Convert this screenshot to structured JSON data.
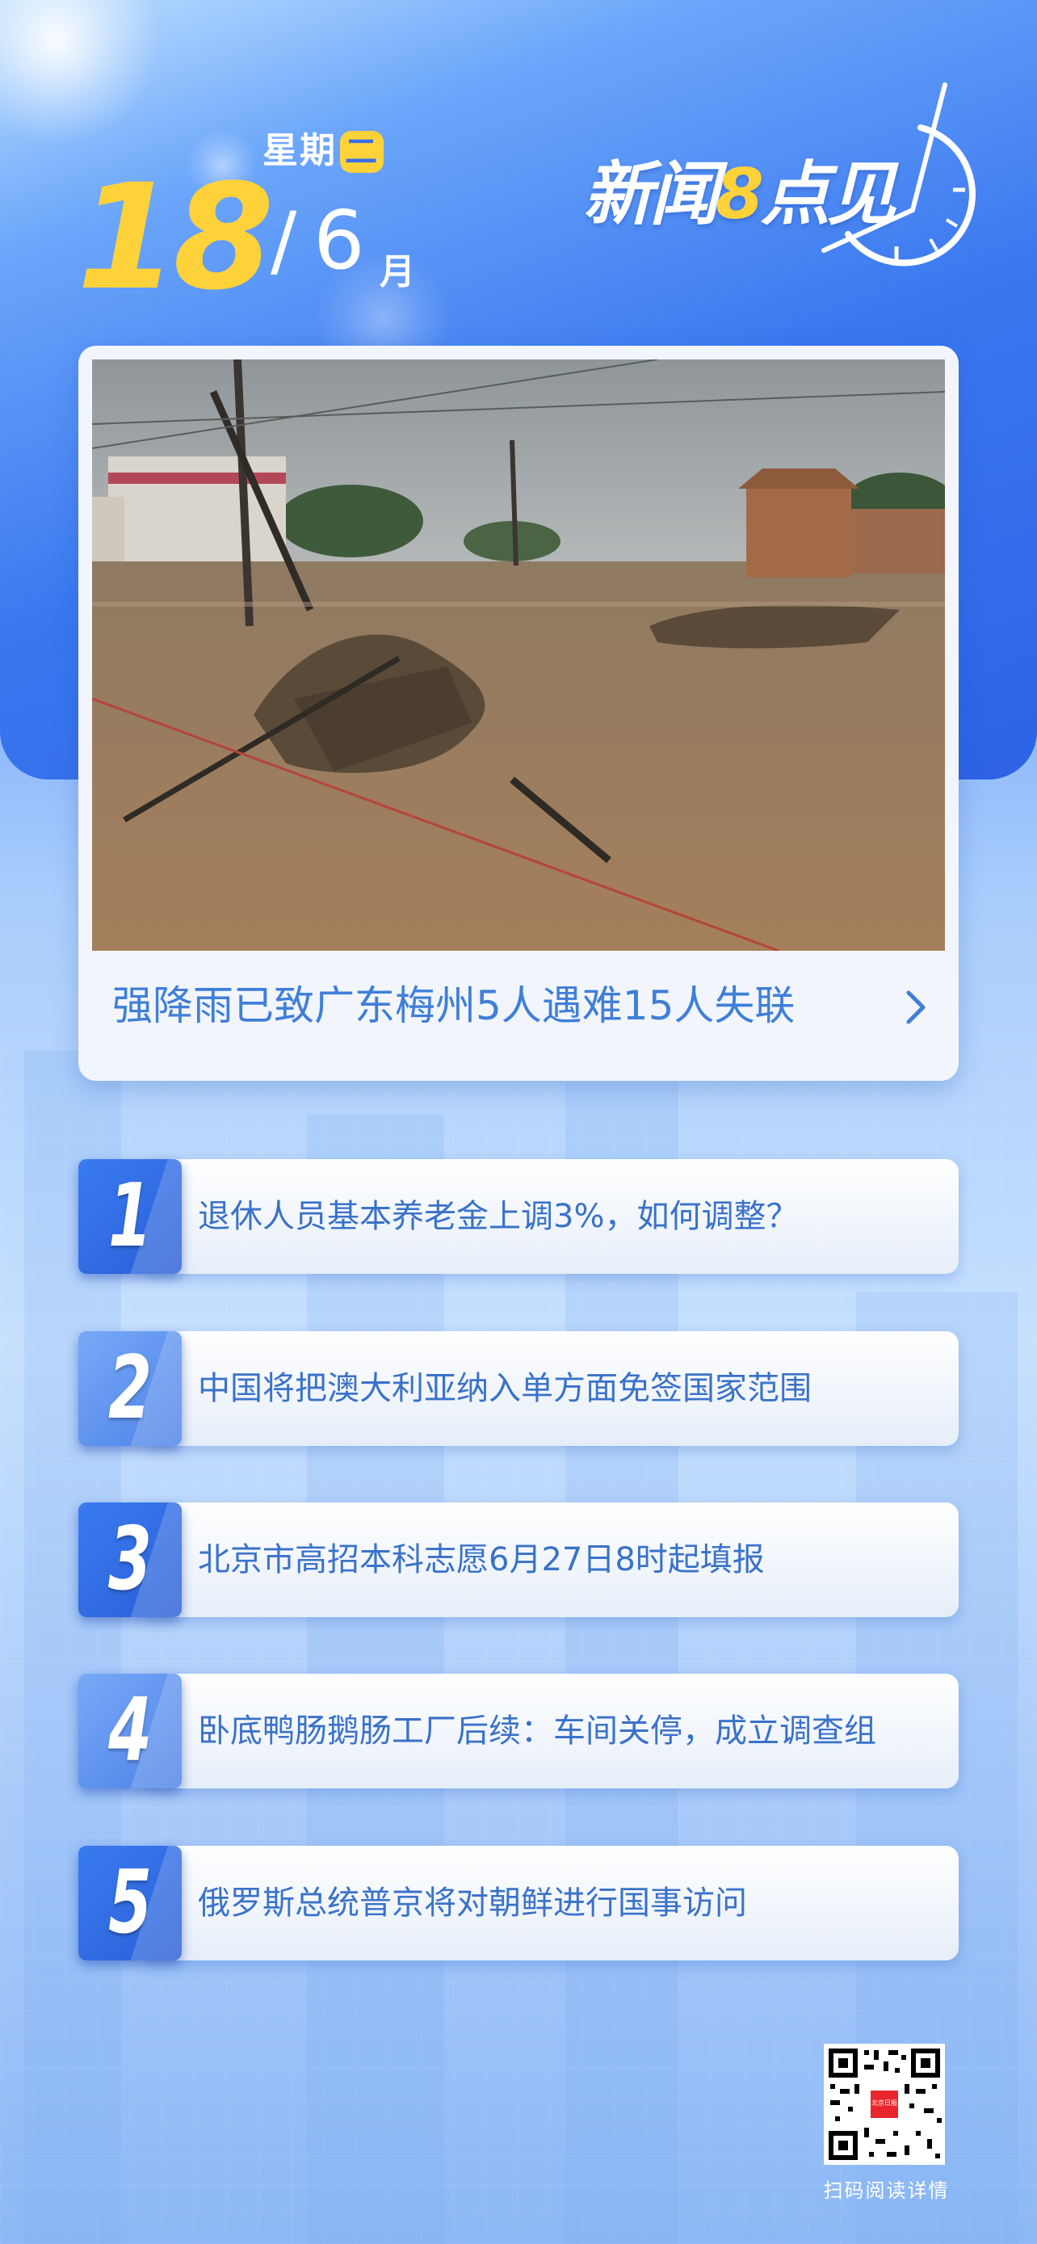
{
  "header": {
    "weekday_prefix": "星期",
    "weekday_char": "二",
    "day": "18",
    "slash": "/",
    "month": "6",
    "month_char": "月",
    "brand_part1": "新闻",
    "brand_eight": "8",
    "brand_part2": "点见"
  },
  "hero": {
    "title": "强降雨已致广东梅州5人遇难15人失联",
    "image_alt": "flooded village photo"
  },
  "news": [
    {
      "num": "1",
      "text": "退休人员基本养老金上调3%，如何调整？"
    },
    {
      "num": "2",
      "text": "中国将把澳大利亚纳入单方面免签国家范围"
    },
    {
      "num": "3",
      "text": "北京市高招本科志愿6月27日8时起填报"
    },
    {
      "num": "4",
      "text": "卧底鸭肠鹅肠工厂后续：车间关停，成立调查组"
    },
    {
      "num": "5",
      "text": "俄罗斯总统普京将对朝鲜进行国事访问"
    }
  ],
  "qr": {
    "caption": "扫码阅读详情",
    "logo_text": "北京日报"
  },
  "colors": {
    "accent_yellow": "#ffd23a",
    "primary_blue": "#3a7bf0",
    "text_blue": "#3a72c8"
  }
}
